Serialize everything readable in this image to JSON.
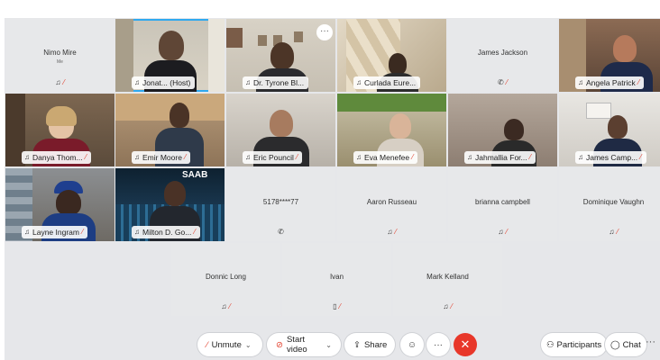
{
  "participants_grid": [
    {
      "name": "Nimo Mire",
      "sub": "Me",
      "type": "placeholder",
      "muted": true,
      "icon": "mic-muted-icon"
    },
    {
      "name": "Jonat... (Host)",
      "type": "video",
      "muted": false,
      "active": true,
      "icon": "speaker-icon"
    },
    {
      "name": "Dr. Tyrone Bl...",
      "type": "video",
      "muted": false,
      "icon": "speaker-icon"
    },
    {
      "name": "Curlada Eure...",
      "type": "video",
      "muted": false,
      "icon": "speaker-icon"
    },
    {
      "name": "James Jackson",
      "type": "placeholder",
      "muted": true,
      "icon": "phone-icon"
    },
    {
      "name": "Angela Patrick",
      "type": "video",
      "muted": true,
      "icon": "speaker-icon"
    },
    {
      "name": "Danya Thom...",
      "type": "video",
      "muted": true,
      "icon": "speaker-icon"
    },
    {
      "name": "Emir Moore",
      "type": "video",
      "muted": true,
      "icon": "speaker-icon"
    },
    {
      "name": "Eric Pouncil",
      "type": "video",
      "muted": true,
      "icon": "speaker-icon"
    },
    {
      "name": "Eva Menefee",
      "type": "video",
      "muted": true,
      "icon": "speaker-icon"
    },
    {
      "name": "Jahmallia For...",
      "type": "video",
      "muted": true,
      "icon": "speaker-icon"
    },
    {
      "name": "James Camp...",
      "type": "video",
      "muted": true,
      "icon": "speaker-icon"
    },
    {
      "name": "Layne Ingram",
      "type": "video",
      "muted": true,
      "icon": "speaker-icon"
    },
    {
      "name": "Milton D. Go...",
      "type": "video",
      "muted": true,
      "icon": "speaker-icon"
    },
    {
      "name": "5178****77",
      "type": "placeholder",
      "muted": false,
      "icon": "phone-icon"
    },
    {
      "name": "Aaron Russeau",
      "type": "placeholder",
      "muted": true,
      "icon": "speaker-icon"
    },
    {
      "name": "brianna campbell",
      "type": "placeholder",
      "muted": true,
      "icon": "speaker-icon"
    },
    {
      "name": "Dominique Vaughn",
      "type": "placeholder",
      "muted": true,
      "icon": "speaker-icon"
    },
    {
      "name": "Donnic Long",
      "type": "placeholder",
      "muted": true,
      "icon": "speaker-icon"
    },
    {
      "name": "Ivan",
      "type": "placeholder",
      "muted": true,
      "icon": "mobile-icon"
    },
    {
      "name": "Mark Kelland",
      "type": "placeholder",
      "muted": true,
      "icon": "speaker-icon"
    }
  ],
  "video_banner_text": "SAAB",
  "toolbar": {
    "unmute": "Unmute",
    "start_video": "Start video",
    "share": "Share",
    "participants": "Participants",
    "chat": "Chat",
    "more": "···",
    "overflow": "···"
  },
  "colors": {
    "accent": "#2fa9ef",
    "danger": "#e8372a",
    "muted": "#e23f2c"
  }
}
